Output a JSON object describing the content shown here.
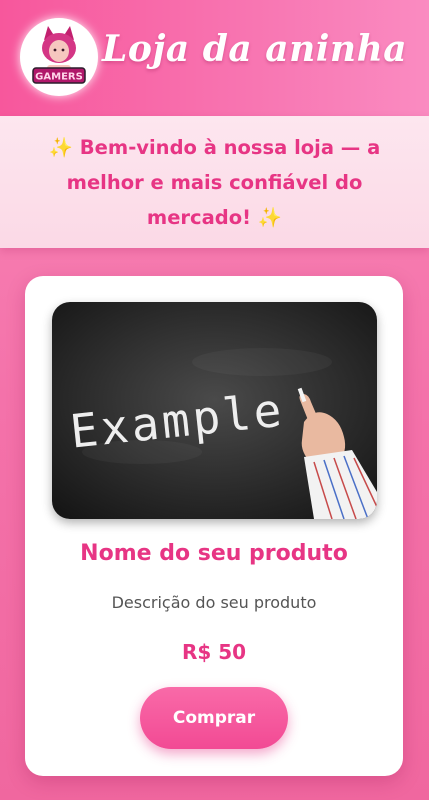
{
  "header": {
    "site_title": "Loja da aninha",
    "logo_text": "GAMERS",
    "logo_icon": "gamer-girl-logo-icon"
  },
  "welcome": {
    "text": "✨ Bem-vindo à nossa loja — a melhor e mais confiável do mercado! ✨"
  },
  "product": {
    "image_text": "Example",
    "image_icon": "chalkboard-hand-writing-image",
    "name": "Nome do seu produto",
    "description": "Descrição do seu produto",
    "price": "R$ 50",
    "buy_label": "Comprar"
  },
  "colors": {
    "brand_pink": "#f7579c",
    "accent_pink": "#e73584",
    "banner_bg": "#fde6ef",
    "card_bg": "#ffffff",
    "description_gray": "#555555"
  }
}
